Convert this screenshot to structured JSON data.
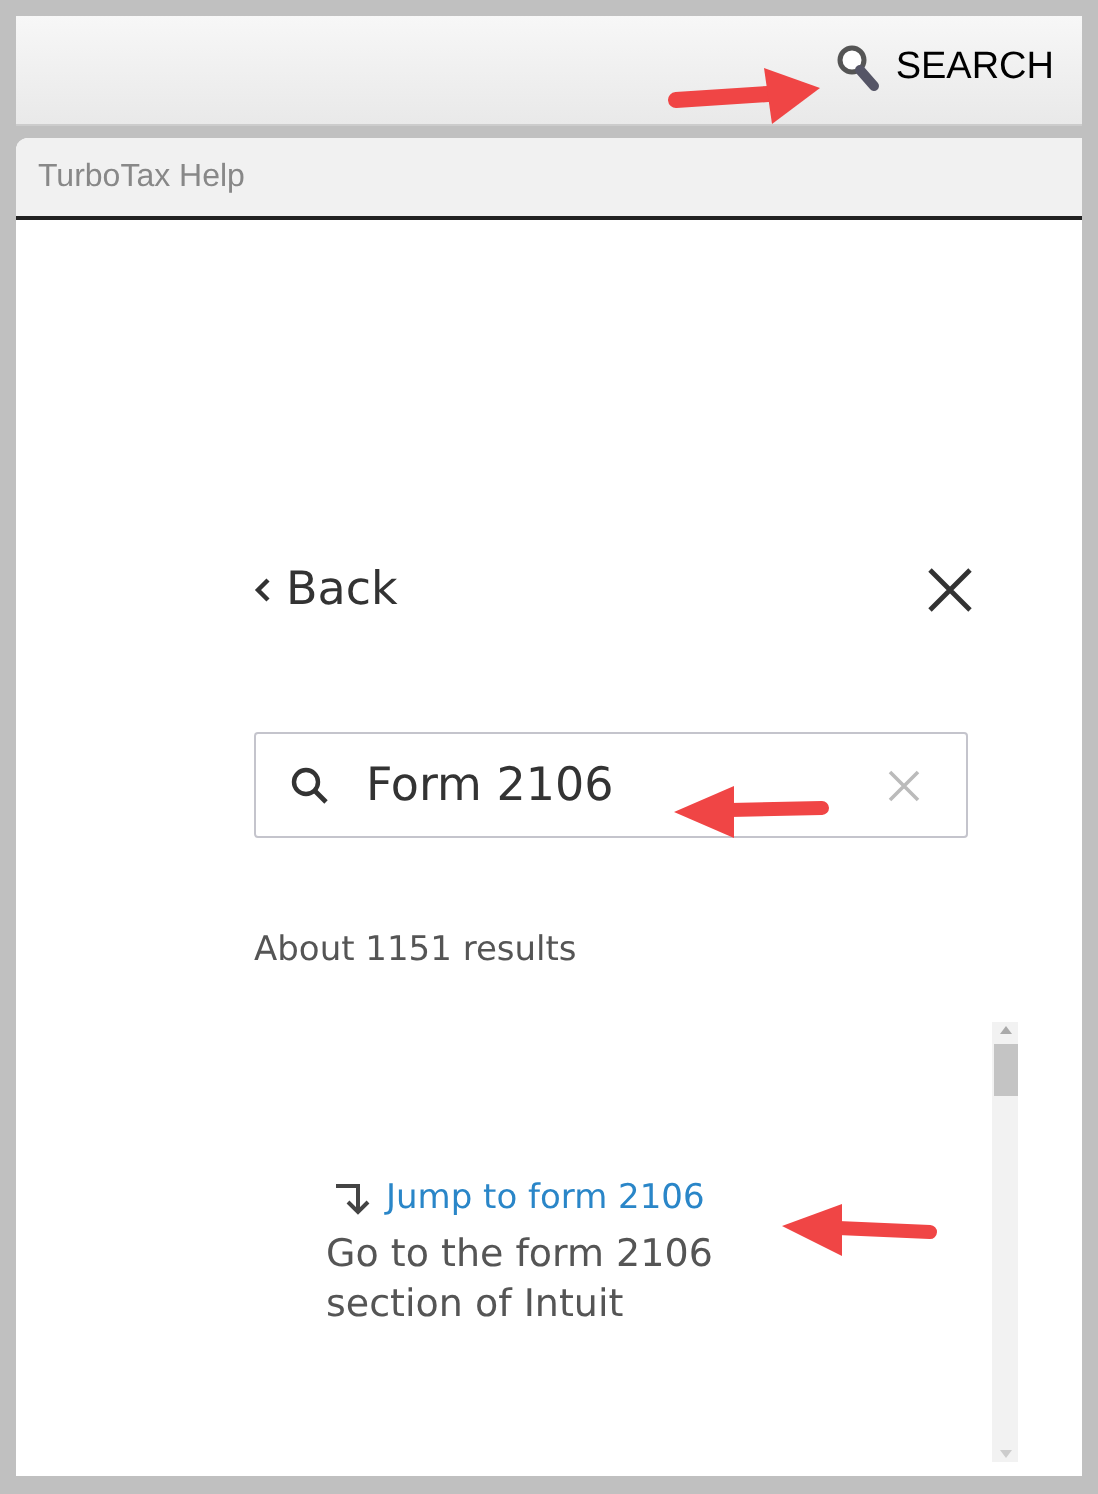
{
  "toolbar": {
    "search_label": "SEARCH"
  },
  "panel": {
    "title": "TurboTax Help"
  },
  "help": {
    "back": "Back",
    "search": {
      "value": "Form 2106"
    },
    "result_count": "About 1151 results",
    "results": [
      {
        "link": "Jump to form 2106",
        "description": "Go to the form 2106 section of Intuit"
      }
    ]
  }
}
